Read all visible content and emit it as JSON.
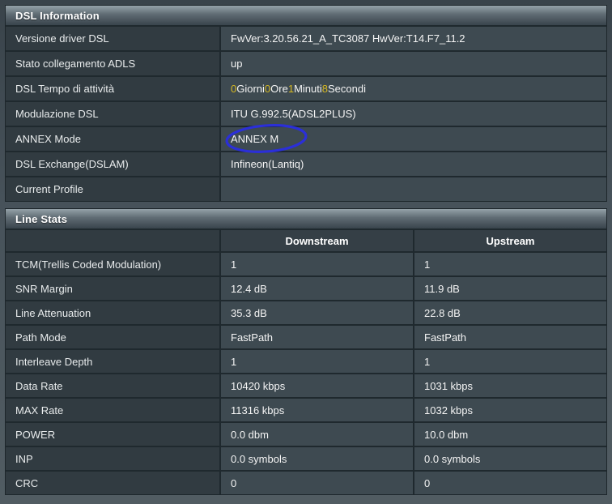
{
  "colors": {
    "highlight_yellow": "#d7b922",
    "annotation_blue": "#2b2fd8",
    "header_light": "#95a2a9",
    "header_dark": "#39444c",
    "label_cell_bg": "#313b41",
    "value_cell_bg": "#3e4a51"
  },
  "dsl_information": {
    "title": "DSL Information",
    "rows": [
      {
        "label": "Versione driver DSL",
        "value": "FwVer:3.20.56.21_A_TC3087 HwVer:T14.F7_11.2"
      },
      {
        "label": "Stato collegamento ADLS",
        "value": "up"
      },
      {
        "label": "DSL Tempo di attività",
        "value_parts": [
          "0",
          " Giorni ",
          "0",
          " Ore ",
          "1",
          " Minuti ",
          "8",
          " Secondi"
        ]
      },
      {
        "label": "Modulazione DSL",
        "value": "ITU G.992.5(ADSL2PLUS)"
      },
      {
        "label": "ANNEX Mode",
        "value": "ANNEX M",
        "annotation": "blue-ellipse"
      },
      {
        "label": "DSL Exchange(DSLAM)",
        "value": "Infineon(Lantiq)"
      },
      {
        "label": "Current Profile",
        "value": ""
      }
    ]
  },
  "line_stats": {
    "title": "Line Stats",
    "columns": [
      "Downstream",
      "Upstream"
    ],
    "rows": [
      {
        "label": "TCM(Trellis Coded Modulation)",
        "downstream": "1",
        "upstream": "1"
      },
      {
        "label": "SNR Margin",
        "downstream": "12.4 dB",
        "upstream": "11.9 dB"
      },
      {
        "label": "Line Attenuation",
        "downstream": "35.3 dB",
        "upstream": "22.8 dB"
      },
      {
        "label": "Path Mode",
        "downstream": "FastPath",
        "upstream": "FastPath"
      },
      {
        "label": "Interleave Depth",
        "downstream": "1",
        "upstream": "1"
      },
      {
        "label": "Data Rate",
        "downstream": "10420 kbps",
        "upstream": "1031 kbps"
      },
      {
        "label": "MAX Rate",
        "downstream": "11316 kbps",
        "upstream": "1032 kbps"
      },
      {
        "label": "POWER",
        "downstream": "0.0 dbm",
        "upstream": "10.0 dbm"
      },
      {
        "label": "INP",
        "downstream": "0.0 symbols",
        "upstream": "0.0 symbols"
      },
      {
        "label": "CRC",
        "downstream": "0",
        "upstream": "0"
      }
    ]
  }
}
